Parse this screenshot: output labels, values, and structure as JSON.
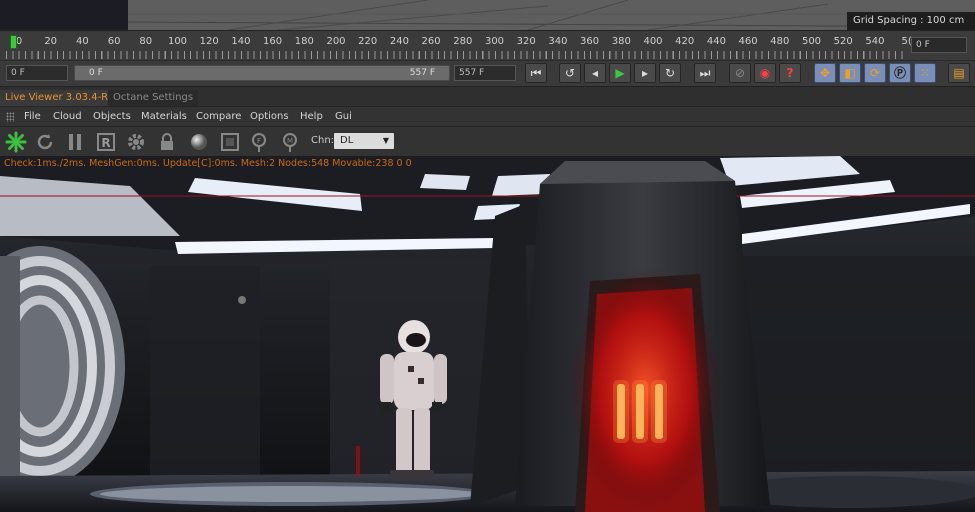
{
  "viewport": {
    "grid_spacing": "Grid Spacing : 100 cm"
  },
  "timeline": {
    "ticks": [
      "0",
      "20",
      "40",
      "60",
      "80",
      "100",
      "120",
      "140",
      "160",
      "180",
      "200",
      "220",
      "240",
      "260",
      "280",
      "300",
      "320",
      "340",
      "360",
      "380",
      "400",
      "420",
      "440",
      "460",
      "480",
      "500",
      "520",
      "540",
      "5("
    ],
    "current_frame": "0 F"
  },
  "transport": {
    "start_frame": "0 F",
    "range_start": "0 F",
    "range_end": "557 F",
    "end_frame": "557 F"
  },
  "tabs": [
    {
      "label": "Live Viewer 3.03.4-R3"
    },
    {
      "label": "Octane Settings"
    }
  ],
  "menu": [
    "File",
    "Cloud",
    "Objects",
    "Materials",
    "Compare",
    "Options",
    "Help",
    "Gui"
  ],
  "toolbar": {
    "channel_label": "Chn:",
    "channel_value": "DL"
  },
  "render": {
    "status": "Check:1ms./2ms. MeshGen:0ms. Update[C]:0ms. Mesh:2 Nodes:548 Movable:238  0 0"
  },
  "colors": {
    "accent_orange": "#e89430",
    "play_green": "#3acb3a",
    "status_orange": "#cc6a10"
  }
}
